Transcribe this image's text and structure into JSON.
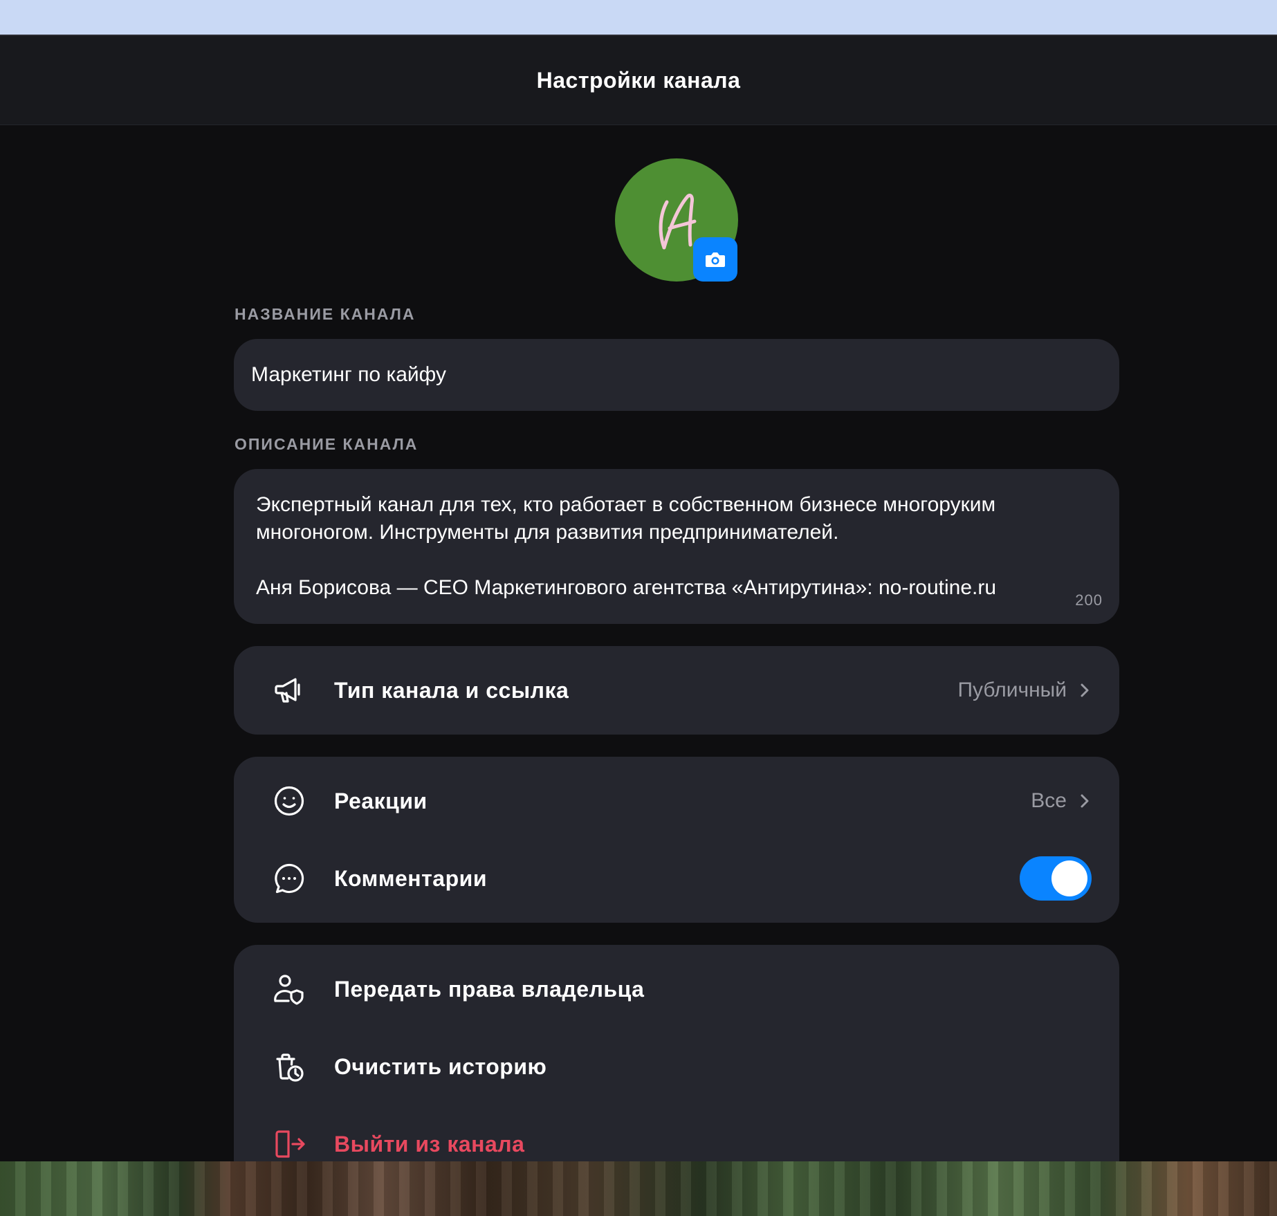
{
  "header": {
    "title": "Настройки канала"
  },
  "avatar": {
    "color": "#4e8f33",
    "monogram_color": "#f4c6d8",
    "camera_icon": "camera-icon",
    "accent": "#0a84ff"
  },
  "name_section": {
    "label": "НАЗВАНИЕ КАНАЛА",
    "value": "Маркетинг по кайфу"
  },
  "description_section": {
    "label": "ОПИСАНИЕ КАНАЛА",
    "line1": "Экспертный канал для тех, кто работает в собственном бизнесе многоруким многоногом. Инструменты для развития  предпринимателей.",
    "line2": "Аня Борисова — CEO Маркетингового агентства «Антирутина»: no-routine.ru",
    "counter": "200"
  },
  "channel_type": {
    "icon": "megaphone-icon",
    "label": "Тип канала и ссылка",
    "value": "Публичный"
  },
  "reactions": {
    "icon": "smiley-icon",
    "label": "Реакции",
    "value": "Все"
  },
  "comments": {
    "icon": "comment-icon",
    "label": "Комментарии",
    "enabled": true
  },
  "actions": {
    "transfer": {
      "icon": "user-shield-icon",
      "label": "Передать права владельца"
    },
    "clear": {
      "icon": "clear-history-icon",
      "label": "Очистить историю"
    },
    "leave": {
      "icon": "exit-icon",
      "label": "Выйти из канала",
      "color": "#e8495f"
    }
  }
}
